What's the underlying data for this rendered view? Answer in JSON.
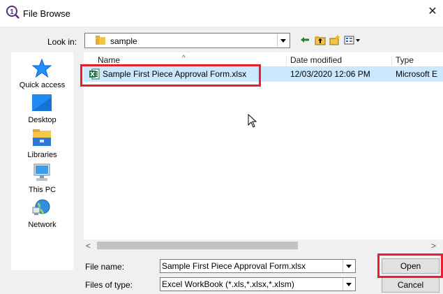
{
  "window": {
    "title": "File Browse",
    "close_glyph": "✕",
    "icon": "app-logo-icon"
  },
  "look_in": {
    "label": "Look in:",
    "value": "sample",
    "folder_icon": "folder-icon"
  },
  "toolbar": {
    "back_icon": "back-arrow-icon",
    "up_icon": "up-folder-icon",
    "new_folder_icon": "new-folder-icon",
    "view_icon": "view-menu-icon"
  },
  "places": [
    {
      "label": "Quick access",
      "icon": "star-icon"
    },
    {
      "label": "Desktop",
      "icon": "desktop-icon"
    },
    {
      "label": "Libraries",
      "icon": "libraries-icon"
    },
    {
      "label": "This PC",
      "icon": "computer-icon"
    },
    {
      "label": "Network",
      "icon": "network-icon"
    }
  ],
  "file_list": {
    "columns": [
      "Name",
      "Date modified",
      "Type"
    ],
    "sort_indicator": "^",
    "rows": [
      {
        "name": "Sample First Piece Approval Form.xlsx",
        "date": "12/03/2020 12:06 PM",
        "type": "Microsoft E",
        "icon": "excel-file-icon",
        "selected": true
      }
    ]
  },
  "scrollbar": {
    "left_glyph": "<",
    "right_glyph": ">"
  },
  "file_name": {
    "label": "File name:",
    "value": "Sample First Piece Approval Form.xlsx"
  },
  "file_type": {
    "label": "Files of type:",
    "value": "Excel WorkBook (*.xls,*.xlsx,*.xlsm)"
  },
  "buttons": {
    "open": "Open",
    "cancel": "Cancel"
  },
  "colors": {
    "highlight": "#e8202e",
    "selection": "#cce8ff",
    "window_bg": "#f0f0f0"
  }
}
